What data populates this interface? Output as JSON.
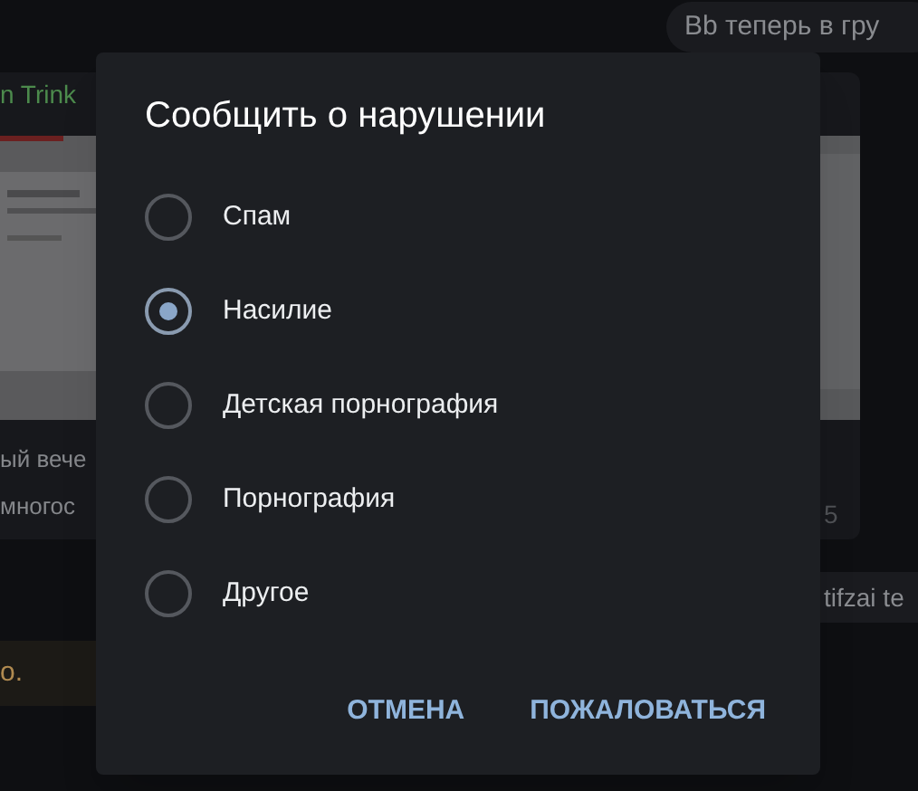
{
  "background": {
    "notice": "Bb теперь в гру",
    "sender": "n Trink",
    "caption_lines": [
      "ый вече",
      "многос"
    ],
    "time": "5",
    "service_note": "tifzai te",
    "warning": "о."
  },
  "dialog": {
    "title": "Сообщить о нарушении",
    "options": [
      {
        "label": "Спам",
        "selected": false
      },
      {
        "label": "Насилие",
        "selected": true
      },
      {
        "label": "Детская порнография",
        "selected": false
      },
      {
        "label": "Порнография",
        "selected": false
      },
      {
        "label": "Другое",
        "selected": false
      }
    ],
    "buttons": [
      "ОТМЕНА",
      "ПОЖАЛОВАТЬСЯ"
    ]
  }
}
